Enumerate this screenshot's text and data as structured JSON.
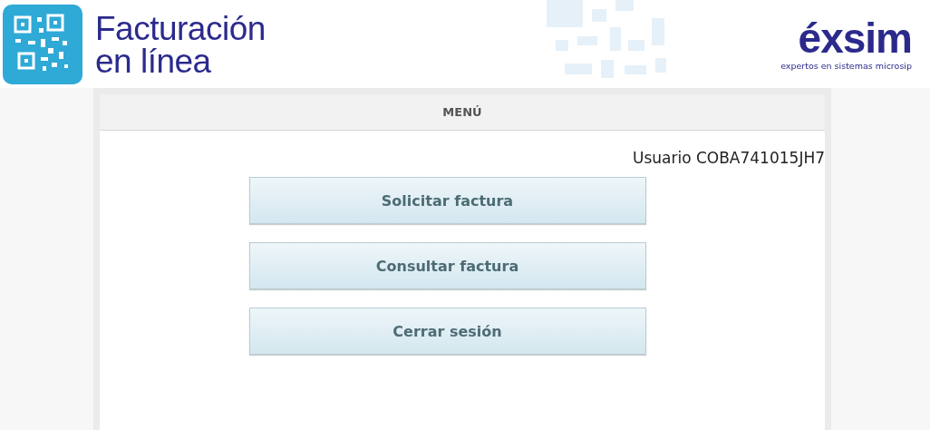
{
  "header": {
    "title_lines": [
      "Facturación",
      "en línea"
    ],
    "brand": {
      "name": "éxsim",
      "tagline": "expertos en sistemas microsip"
    }
  },
  "menu": {
    "title": "MENÚ",
    "user": "Usuario COBA741015JH7",
    "buttons": [
      "Solicitar factura",
      "Consultar factura",
      "Cerrar sesión"
    ]
  }
}
